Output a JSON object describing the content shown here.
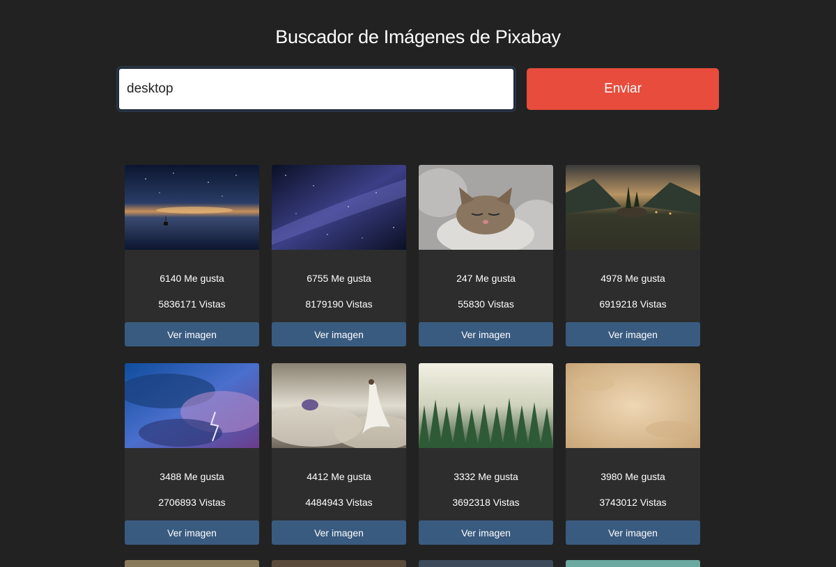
{
  "header": {
    "title": "Buscador de Imágenes de Pixabay"
  },
  "search": {
    "value": "desktop",
    "submit_label": "Enviar"
  },
  "results": [
    {
      "likes": "6140 Me gusta",
      "views": "5836171 Vistas",
      "button": "Ver imagen"
    },
    {
      "likes": "6755 Me gusta",
      "views": "8179190 Vistas",
      "button": "Ver imagen"
    },
    {
      "likes": "247 Me gusta",
      "views": "55830 Vistas",
      "button": "Ver imagen"
    },
    {
      "likes": "4978 Me gusta",
      "views": "6919218 Vistas",
      "button": "Ver imagen"
    },
    {
      "likes": "3488 Me gusta",
      "views": "2706893 Vistas",
      "button": "Ver imagen"
    },
    {
      "likes": "4412 Me gusta",
      "views": "4484943 Vistas",
      "button": "Ver imagen"
    },
    {
      "likes": "3332 Me gusta",
      "views": "3692318 Vistas",
      "button": "Ver imagen"
    },
    {
      "likes": "3980 Me gusta",
      "views": "3743012 Vistas",
      "button": "Ver imagen"
    }
  ],
  "colors": {
    "background": "#222222",
    "card": "#2d2d2d",
    "submit": "#e74c3c",
    "view_button": "#3a5b80"
  }
}
